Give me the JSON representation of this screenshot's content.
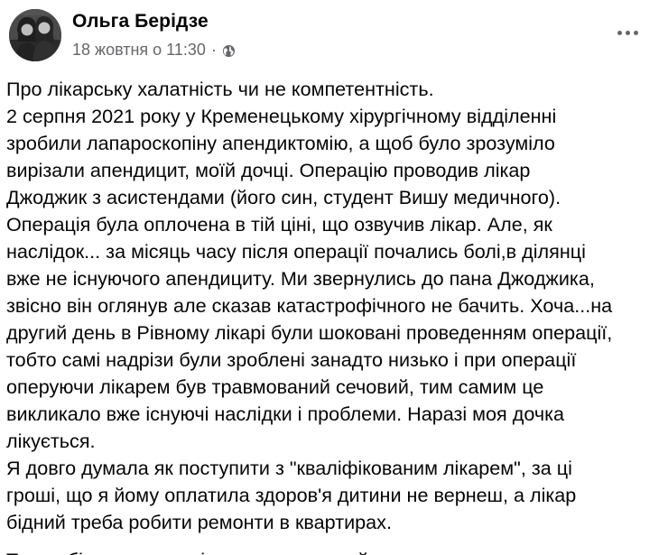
{
  "post": {
    "author_name": "Ольга Берідзе",
    "timestamp": "18 жовтня о 11:30",
    "separator": "·",
    "privacy_icon": "globe-icon",
    "more_icon": "more-options-icon",
    "paragraphs": [
      "Про лікарську халатність чи не компетентність.\n2 серпня 2021 року у Кременецькому хірургічному відділенні\nзробили лапароскопіну апендиктомію, а щоб було зрозуміло\nвирізали апендицит, моїй дочці. Операцію проводив лікар\nДжоджик з асистендами (його син, студент Вишу медичного).\nОперація була оплочена в тій ціні, що озвучив лікар. Але, як\nнаслідок...  за місяць часу після операції почались болі,в ділянці\nвже не існуючого апендициту. Ми звернулись до пана Джоджика,\nзвісно він оглянув але сказав катастрофічного не бачить. Хоча...на\nдругий день в Рівному лікарі були шоковані проведенням операції,\nтобто самі надрізи були зроблені занадто низько і при операції\nоперуючи лікарем був травмований сечовий, тим самим це\nвикликало вже існуючі наслідки і проблеми. Наразі моя дочка\nлікується.\nЯ довго думала як поступити з \"кваліфікованим лікарем\", за ці\nгроші, що я йому оплатила здоров'я дитини не вернеш,  а лікар\nбідний треба робити ремонти в квартирах.",
      "Тож робіть висновки, і раджу вам минайте стороною, адже те, що"
    ]
  }
}
